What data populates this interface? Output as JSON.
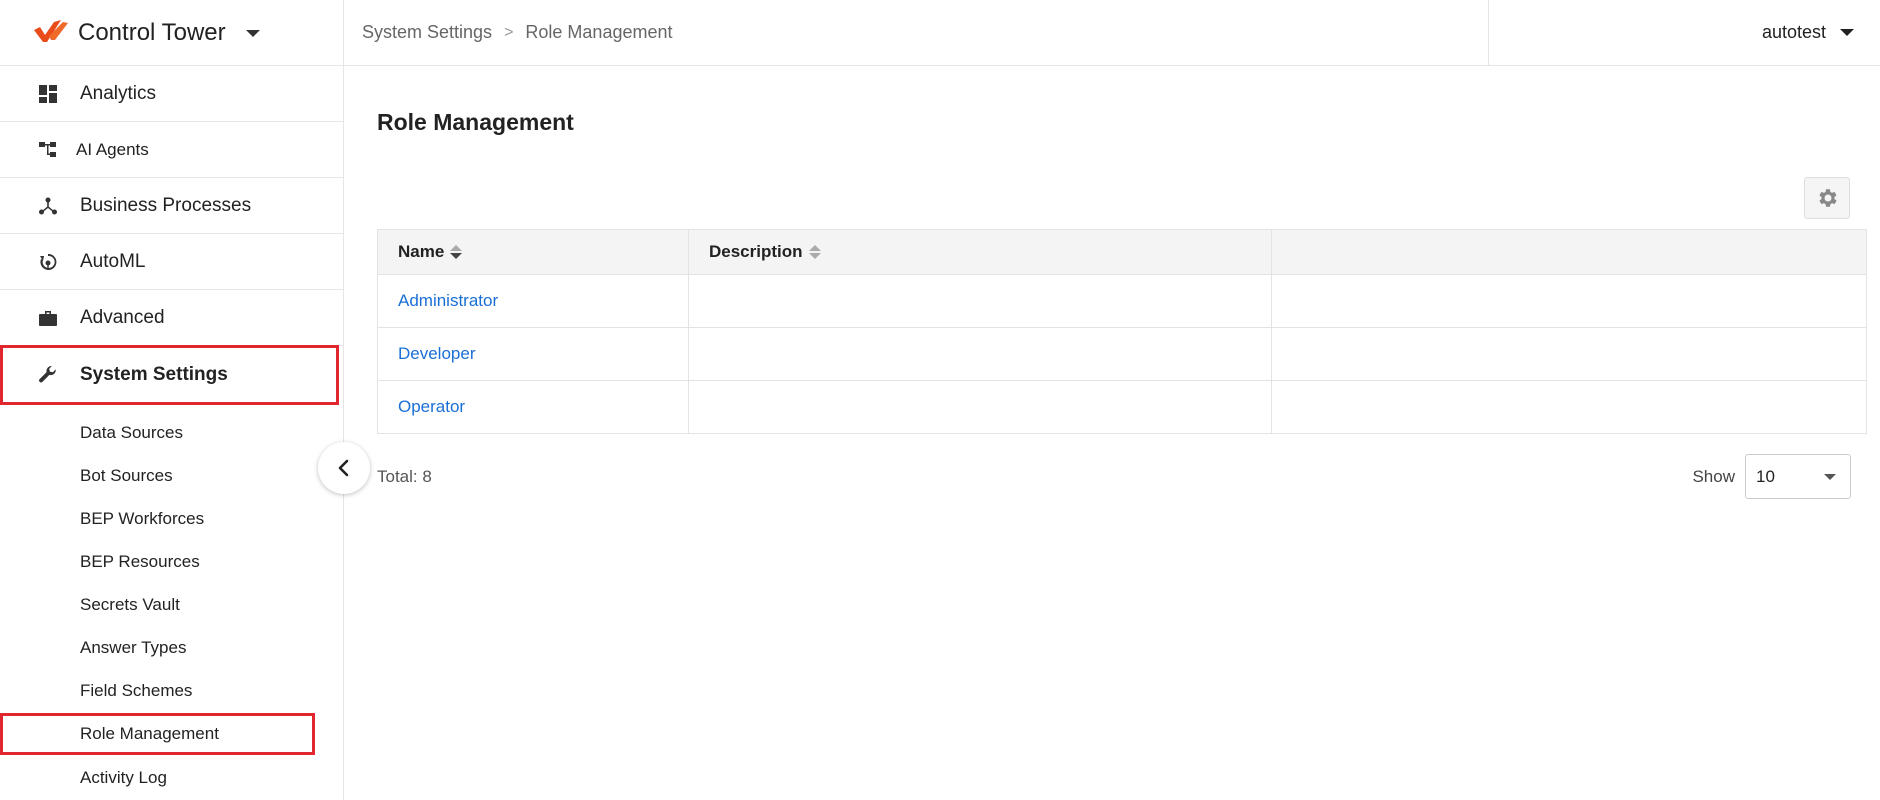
{
  "app": {
    "title": "Control Tower"
  },
  "brand": {
    "accent": "#e94b1b"
  },
  "nav": {
    "items": [
      {
        "label": "Analytics",
        "icon": "dashboard-icon"
      },
      {
        "label": "AI Agents",
        "icon": "hierarchy-icon"
      },
      {
        "label": "Business Processes",
        "icon": "process-icon"
      },
      {
        "label": "AutoML",
        "icon": "automl-icon"
      },
      {
        "label": "Advanced",
        "icon": "briefcase-icon"
      },
      {
        "label": "System Settings",
        "icon": "wrench-icon",
        "active": true
      }
    ],
    "sub_items": [
      {
        "label": "Data Sources"
      },
      {
        "label": "Bot Sources"
      },
      {
        "label": "BEP Workforces"
      },
      {
        "label": "BEP Resources"
      },
      {
        "label": "Secrets Vault"
      },
      {
        "label": "Answer Types"
      },
      {
        "label": "Field Schemes"
      },
      {
        "label": "Role Management",
        "active": true
      },
      {
        "label": "Activity Log"
      }
    ]
  },
  "breadcrumb": {
    "parent": "System Settings",
    "current": "Role Management",
    "separator": ">"
  },
  "user": {
    "name": "autotest"
  },
  "page": {
    "title": "Role Management"
  },
  "table": {
    "columns": [
      "Name",
      "Description",
      ""
    ],
    "rows": [
      {
        "name": "Administrator",
        "description": ""
      },
      {
        "name": "Developer",
        "description": ""
      },
      {
        "name": "Operator",
        "description": ""
      }
    ]
  },
  "footer": {
    "total": "Total: 8",
    "show_label": "Show",
    "page_size": "10"
  },
  "colors": {
    "active_border": "#e0262e",
    "link": "#1a6fd6"
  }
}
